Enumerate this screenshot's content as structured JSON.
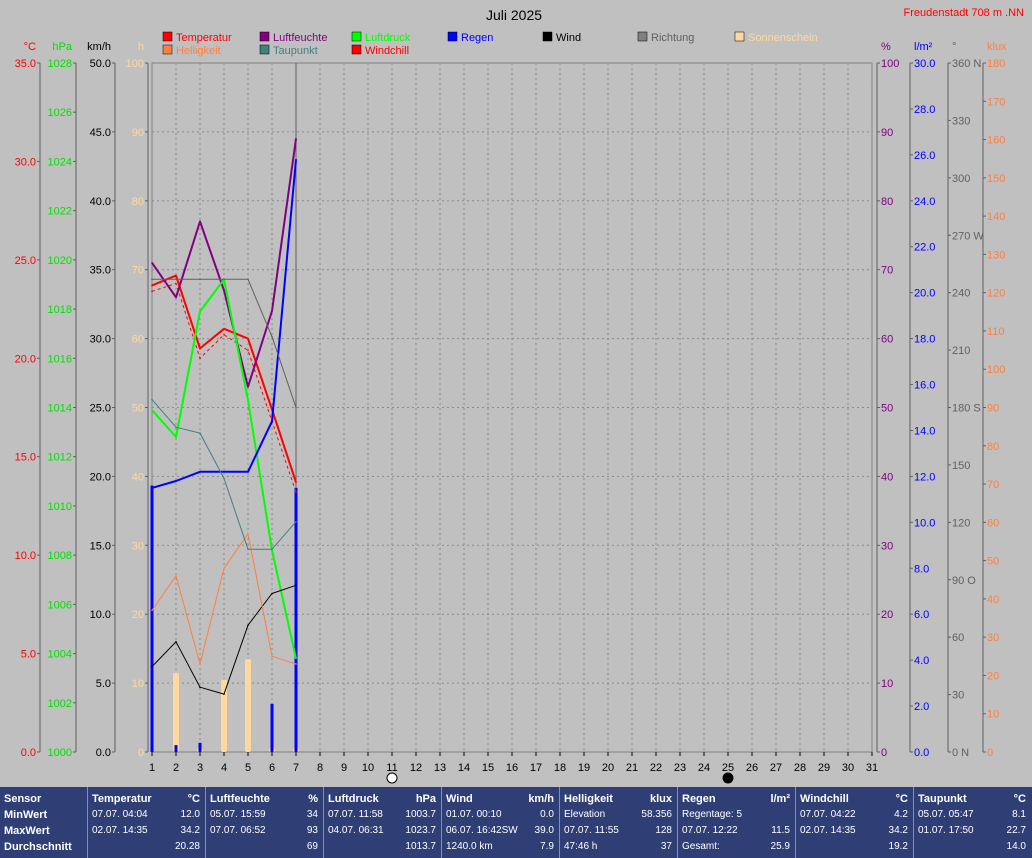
{
  "title": "Juli 2025",
  "location": "Freudenstadt 708 m  .NN",
  "legend": [
    {
      "label": "Temperatur",
      "color": "#ff0000"
    },
    {
      "label": "Luftfeuchte",
      "color": "#800080"
    },
    {
      "label": "Luftdruck",
      "color": "#00ff00"
    },
    {
      "label": "Regen",
      "color": "#0000ff"
    },
    {
      "label": "Wind",
      "color": "#000000"
    },
    {
      "label": "Richtung",
      "color": "#808080"
    },
    {
      "label": "Sonnenschein",
      "color": "#ffd8a0"
    },
    {
      "label": "Helligkeit",
      "color": "#ff7f3f"
    },
    {
      "label": "Taupunkt",
      "color": "#408080"
    },
    {
      "label": "Windchill",
      "color": "#ff0000"
    }
  ],
  "axes": {
    "temp": {
      "unit": "°C",
      "ticks": [
        "35.0",
        "30.0",
        "25.0",
        "20.0",
        "15.0",
        "10.0",
        "5.0",
        "0.0"
      ],
      "color": "#ff0000"
    },
    "pressure": {
      "unit": "hPa",
      "ticks": [
        "1028",
        "1026",
        "1024",
        "1022",
        "1020",
        "1018",
        "1016",
        "1014",
        "1012",
        "1010",
        "1008",
        "1006",
        "1004",
        "1002",
        "1000"
      ],
      "color": "#00e000"
    },
    "wind": {
      "unit": "km/h",
      "ticks": [
        "50.0",
        "45.0",
        "40.0",
        "35.0",
        "30.0",
        "25.0",
        "20.0",
        "15.0",
        "10.0",
        "5.0",
        "0.0"
      ],
      "color": "#000000"
    },
    "sun": {
      "unit": "h",
      "ticks": [
        "100",
        "90",
        "80",
        "70",
        "60",
        "50",
        "40",
        "30",
        "20",
        "10",
        "0"
      ],
      "color": "#ffd8a0"
    },
    "humidity": {
      "unit": "%",
      "ticks": [
        "100",
        "90",
        "80",
        "70",
        "60",
        "50",
        "40",
        "30",
        "20",
        "10",
        "0"
      ],
      "color": "#800080"
    },
    "rain": {
      "unit": "l/m²",
      "ticks": [
        "30.0",
        "28.0",
        "26.0",
        "24.0",
        "22.0",
        "20.0",
        "18.0",
        "16.0",
        "14.0",
        "12.0",
        "10.0",
        "8.0",
        "6.0",
        "4.0",
        "2.0",
        "0.0"
      ],
      "color": "#0000ff"
    },
    "direction": {
      "unit": "°",
      "ticks": [
        "360 N",
        "330",
        "300",
        "270 W",
        "240",
        "210",
        "180 S",
        "150",
        "120",
        "90 O",
        "60",
        "30",
        "0 N"
      ],
      "color": "#606060"
    },
    "lux": {
      "unit": "klux",
      "ticks": [
        "180",
        "170",
        "160",
        "150",
        "140",
        "130",
        "120",
        "110",
        "100",
        "90",
        "80",
        "70",
        "60",
        "50",
        "40",
        "30",
        "20",
        "10",
        "0"
      ],
      "color": "#ff7f3f"
    }
  },
  "x_ticks": [
    "1",
    "2",
    "3",
    "4",
    "5",
    "6",
    "7",
    "8",
    "9",
    "10",
    "11",
    "12",
    "13",
    "14",
    "15",
    "16",
    "17",
    "18",
    "19",
    "20",
    "21",
    "22",
    "23",
    "24",
    "25",
    "26",
    "27",
    "28",
    "29",
    "30",
    "31"
  ],
  "chart_data": {
    "type": "line",
    "title": "Juli 2025",
    "x": [
      1,
      2,
      3,
      4,
      5,
      6,
      7
    ],
    "xlim": [
      1,
      31
    ],
    "series": [
      {
        "name": "Temperatur",
        "axis": "temp",
        "color": "#ff0000",
        "width": 2,
        "values": [
          23.7,
          24.2,
          20.5,
          21.5,
          21.0,
          17.4,
          13.7
        ]
      },
      {
        "name": "Windchill",
        "axis": "temp",
        "color": "#ff0000",
        "width": 1,
        "dash": true,
        "values": [
          23.4,
          23.8,
          20.0,
          21.2,
          20.4,
          16.8,
          13.2
        ]
      },
      {
        "name": "Luftfeuchte",
        "axis": "humidity",
        "color": "#800080",
        "width": 2,
        "values": [
          71,
          66,
          77,
          67,
          53,
          64,
          89
        ]
      },
      {
        "name": "Luftdruck",
        "axis": "pressure",
        "color": "#00ff00",
        "width": 2,
        "values": [
          1013.9,
          1012.8,
          1017.9,
          1019.2,
          1014.3,
          1008.2,
          1003.8
        ]
      },
      {
        "name": "Regen (Summe)",
        "axis": "rain",
        "color": "#0000ff",
        "width": 2,
        "values": [
          11.5,
          11.8,
          12.2,
          12.2,
          12.2,
          14.4,
          25.8
        ]
      },
      {
        "name": "Wind",
        "axis": "wind",
        "color": "#000000",
        "width": 1,
        "values": [
          6.2,
          8.0,
          4.7,
          4.2,
          9.2,
          11.5,
          12.1
        ]
      },
      {
        "name": "Richtung",
        "axis": "direction",
        "color": "#606060",
        "width": 1,
        "values": [
          247,
          247,
          247,
          247,
          247,
          217,
          180
        ]
      },
      {
        "name": "Helligkeit",
        "axis": "lux",
        "color": "#ff7f3f",
        "width": 1,
        "values": [
          37,
          46,
          23,
          48,
          57,
          25,
          23
        ]
      },
      {
        "name": "Taupunkt",
        "axis": "temp",
        "color": "#408080",
        "width": 1,
        "values": [
          17.9,
          16.5,
          16.2,
          13.9,
          10.3,
          10.3,
          11.7
        ]
      }
    ],
    "bars": [
      {
        "name": "Sonnenschein",
        "axis": "sun",
        "color": "#ffd8a0",
        "width": 6,
        "x": [
          2,
          3,
          4,
          5,
          6,
          7
        ],
        "values": [
          11.5,
          0.5,
          10.5,
          13.5,
          0.5,
          0.5
        ]
      },
      {
        "name": "Regen (Tag)",
        "axis": "rain",
        "color": "#0000ff",
        "width": 3,
        "x": [
          1,
          2,
          3,
          6,
          7
        ],
        "values": [
          11.6,
          0.3,
          0.4,
          2.1,
          11.5
        ]
      }
    ],
    "moon": [
      {
        "day": 11,
        "phase": "full"
      },
      {
        "day": 25,
        "phase": "new"
      }
    ]
  },
  "stats": {
    "labels": {
      "sensor": "Sensor",
      "min": "MinWert",
      "max": "MaxWert",
      "avg": "Durchschnitt"
    },
    "temp": {
      "head": "Temperatur",
      "unit": "°C",
      "min_t": "07.07.  04:04",
      "min": "12.0",
      "max_t": "02.07.  14:35",
      "max": "34.2",
      "avg": "20.28"
    },
    "hum": {
      "head": "Luftfeuchte",
      "unit": "%",
      "min_t": "05.07.  15:59",
      "min": "34",
      "max_t": "07.07.  06:52",
      "max": "93",
      "avg": "69"
    },
    "pres": {
      "head": "Luftdruck",
      "unit": "hPa",
      "min_t": "07.07.  11:58",
      "min": "1003.7",
      "max_t": "04.07.  06:31",
      "max": "1023.7",
      "avg": "1013.7"
    },
    "wind": {
      "head": "Wind",
      "unit": "km/h",
      "min_t": "01.07.  00:10",
      "min": "0.0",
      "max_t": "06.07.  16:42SW",
      "max": "39.0",
      "avg_t": "1240.0 km",
      "avg": "7.9"
    },
    "lux": {
      "head": "Helligkeit",
      "unit": "klux",
      "r1_t": "Elevation",
      "r1": "58.356",
      "r2_t": "07.07.  11:55",
      "r2": "128",
      "r3_t": "47:46 h",
      "r3": "37"
    },
    "rain": {
      "head": "Regen",
      "unit": "l/m²",
      "r1_t": "Regentage: 5",
      "r1": "",
      "r2_t": "07.07.  12:22",
      "r2": "11.5",
      "r3_t": "Gesamt:",
      "r3": "25.9"
    },
    "chill": {
      "head": "Windchill",
      "unit": "°C",
      "min_t": "07.07.  04:22",
      "min": "4.2",
      "max_t": "02.07.  14:35",
      "max": "34.2",
      "avg": "19.2"
    },
    "dew": {
      "head": "Taupunkt",
      "unit": "°C",
      "min_t": "05.07.  05:47",
      "min": "8.1",
      "max_t": "01.07.  17:50",
      "max": "22.7",
      "avg": "14.0"
    }
  }
}
